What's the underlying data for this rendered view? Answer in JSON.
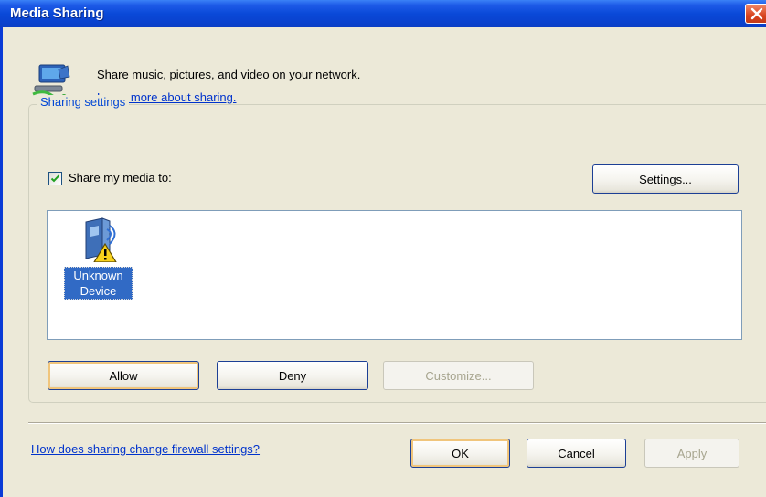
{
  "window": {
    "title": "Media Sharing"
  },
  "header": {
    "description": "Share music, pictures, and video on your network.",
    "learn_more_link": "Learn more about sharing."
  },
  "sharing_settings": {
    "group_label": "Sharing settings",
    "share_checkbox_label": "Share my media to:",
    "share_checked": true,
    "settings_button": "Settings...",
    "devices": [
      {
        "name_line1": "Unknown",
        "name_line2": "Device",
        "selected": true,
        "icon": "unknown-device-warning-icon"
      }
    ],
    "allow_button": "Allow",
    "deny_button": "Deny",
    "customize_button": "Customize..."
  },
  "footer": {
    "firewall_link": "How does sharing change firewall settings?",
    "ok_button": "OK",
    "cancel_button": "Cancel",
    "apply_button": "Apply"
  },
  "colors": {
    "titlebar": "#0a49d8",
    "dialog_bg": "#ece9d8",
    "link": "#0033cc",
    "group_label": "#0046d5",
    "selection": "#316ac5"
  }
}
